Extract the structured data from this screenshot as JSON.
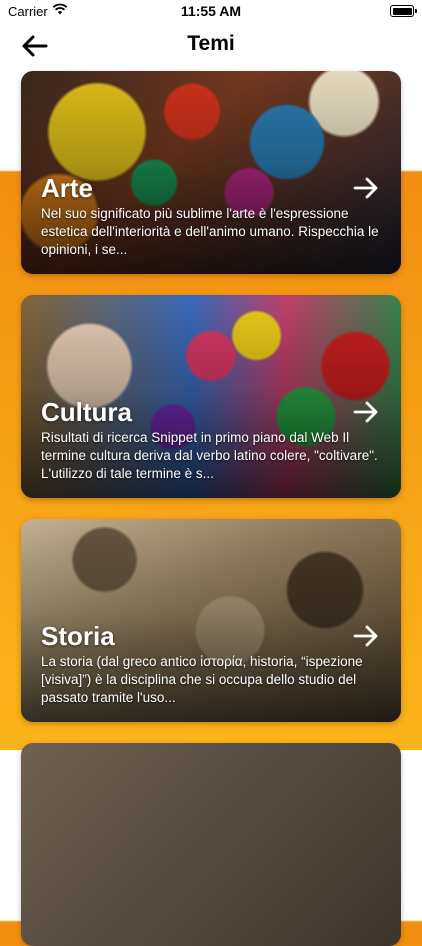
{
  "status_bar": {
    "carrier": "Carrier",
    "time": "11:55 AM"
  },
  "nav": {
    "title": "Temi",
    "back_icon": "arrow-left-icon"
  },
  "topics": [
    {
      "title": "Arte",
      "description": "Nel suo significato più sublime l'arte è l'espressione estetica dell'interiorità e dell'animo umano. Rispecchia le opinioni, i se...",
      "arrow_icon": "arrow-right-icon"
    },
    {
      "title": "Cultura",
      "description": "Risultati di ricerca Snippet in primo piano dal Web Il termine cultura deriva dal verbo latino colere, \"coltivare\". L'utilizzo di tale termine è s...",
      "arrow_icon": "arrow-right-icon"
    },
    {
      "title": "Storia",
      "description": "La storia (dal greco antico ἱστορία, historia, “ispezione [visiva]”) è la disciplina che si occupa dello studio del passato tramite l'uso...",
      "arrow_icon": "arrow-right-icon"
    }
  ],
  "colors": {
    "background_top": "#ffffff",
    "background_gradient_start": "#f28e12",
    "background_gradient_end": "#fbb418",
    "text_on_card": "#ffffff"
  }
}
